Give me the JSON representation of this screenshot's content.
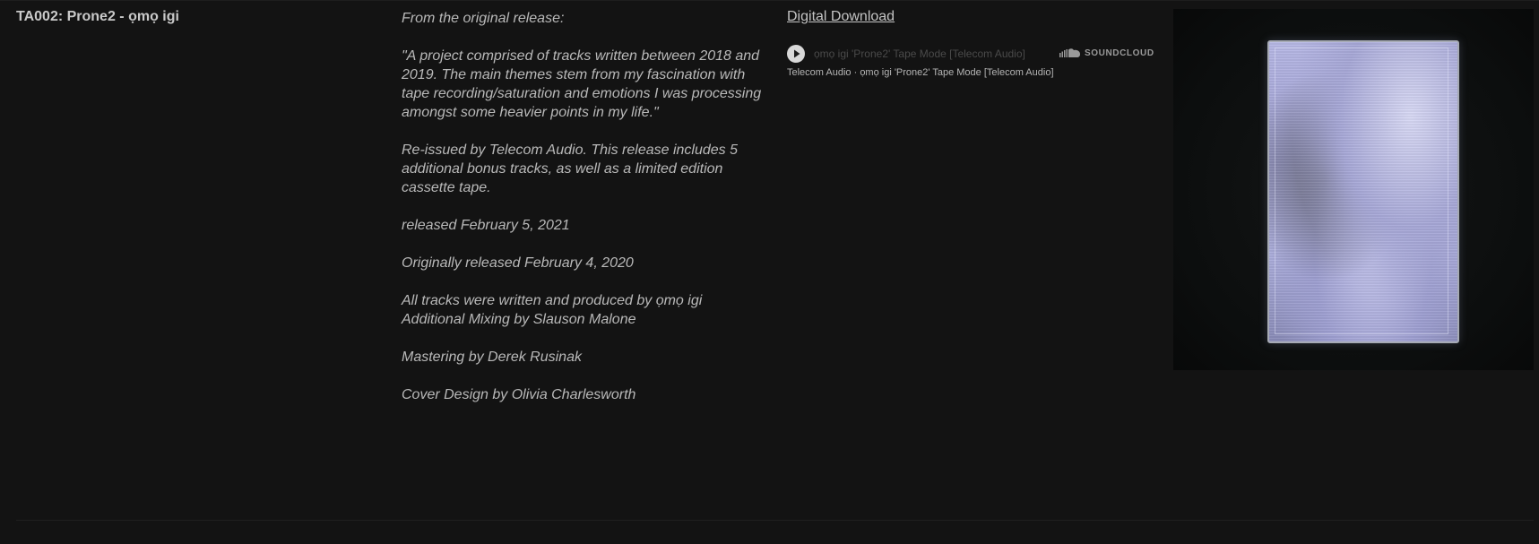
{
  "release": {
    "title": "TA002: Prone2 - ọmọ igi"
  },
  "notes": {
    "paragraphs": [
      "From the original release:",
      "\"A project comprised of tracks written between 2018 and 2019. The main themes stem from my fascination with tape recording/saturation and emotions I was processing amongst some heavier points in my life.\"",
      "Re-issued by Telecom Audio. This release includes 5 additional bonus tracks, as well as a limited edition cassette tape.",
      "released February 5, 2021",
      "Originally released February 4, 2020",
      "All tracks were written and produced by ọmọ igi\nAdditional Mixing by Slauson Malone",
      "Mastering by Derek Rusinak",
      "Cover Design by Olivia Charlesworth"
    ]
  },
  "download": {
    "label": "Digital Download"
  },
  "player": {
    "track": "ọmọ igi 'Prone2' Tape Mode [Telecom Audio]",
    "logo_text": "SOUNDCLOUD",
    "caption": "Telecom Audio · ọmọ igi 'Prone2' Tape Mode [Telecom Audio]",
    "play_icon": "play-icon",
    "logo_icon": "soundcloud-icon"
  },
  "colors": {
    "background": "#131313",
    "text": "#bdbdbd",
    "cassette": "#a9aade"
  }
}
